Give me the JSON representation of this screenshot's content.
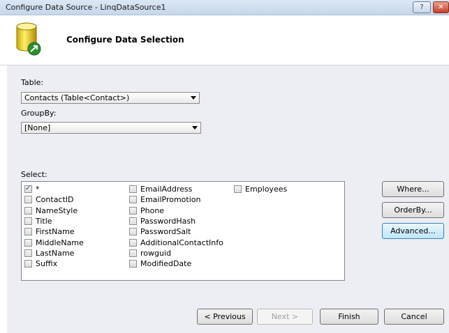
{
  "window": {
    "title": "Configure Data Source - LinqDataSource1",
    "help_label": "?",
    "close_label": "✕"
  },
  "header": {
    "heading": "Configure Data Selection"
  },
  "form": {
    "table_label": "Table:",
    "table_value": "Contacts (Table<Contact>)",
    "groupby_label": "GroupBy:",
    "groupby_value": "[None]",
    "select_label": "Select:"
  },
  "select_columns": {
    "col1": [
      {
        "label": "*",
        "checked": true
      },
      {
        "label": "ContactID",
        "checked": false
      },
      {
        "label": "NameStyle",
        "checked": false
      },
      {
        "label": "Title",
        "checked": false
      },
      {
        "label": "FirstName",
        "checked": false
      },
      {
        "label": "MiddleName",
        "checked": false
      },
      {
        "label": "LastName",
        "checked": false
      },
      {
        "label": "Suffix",
        "checked": false
      }
    ],
    "col2": [
      {
        "label": "EmailAddress",
        "checked": false
      },
      {
        "label": "EmailPromotion",
        "checked": false
      },
      {
        "label": "Phone",
        "checked": false
      },
      {
        "label": "PasswordHash",
        "checked": false
      },
      {
        "label": "PasswordSalt",
        "checked": false
      },
      {
        "label": "AdditionalContactInfo",
        "checked": false
      },
      {
        "label": "rowguid",
        "checked": false
      },
      {
        "label": "ModifiedDate",
        "checked": false
      }
    ],
    "col3": [
      {
        "label": "Employees",
        "checked": false
      }
    ]
  },
  "side_buttons": {
    "where": "Where...",
    "orderby": "OrderBy...",
    "advanced": "Advanced..."
  },
  "footer_buttons": {
    "previous": "< Previous",
    "next": "Next >",
    "finish": "Finish",
    "cancel": "Cancel"
  }
}
